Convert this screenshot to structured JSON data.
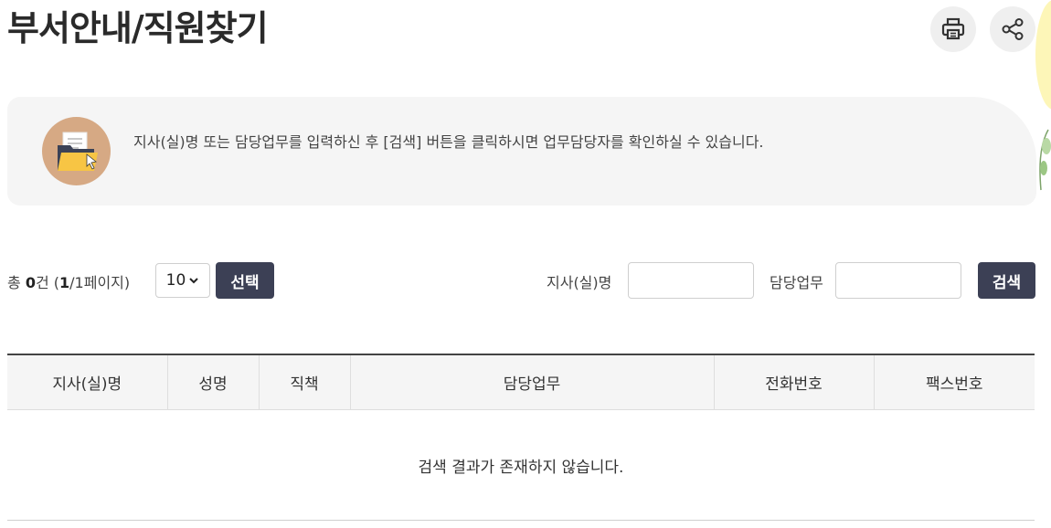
{
  "page": {
    "title": "부서안내/직원찾기"
  },
  "header_actions": {
    "print_icon": "printer-icon",
    "share_icon": "share-icon"
  },
  "info": {
    "icon": "folder-document-icon",
    "text": "지사(실)명 또는 담당업무를 입력하신 후 [검색] 버튼을 클릭하시면 업무담당자를 확인하실 수 있습니다."
  },
  "toolbar": {
    "total_prefix": "총 ",
    "total_count": "0",
    "total_suffix": "건 (",
    "current_page": "1",
    "page_sep": "/",
    "total_pages": "1",
    "page_suffix": "페이지)",
    "per_page_value": "10",
    "select_label": "선택",
    "branch_label": "지사(실)명",
    "branch_value": "",
    "duty_label": "담당업무",
    "duty_value": "",
    "search_label": "검색"
  },
  "table": {
    "columns": [
      "지사(실)명",
      "성명",
      "직책",
      "담당업무",
      "전화번호",
      "팩스번호"
    ],
    "empty_message": "검색 결과가 존재하지 않습니다."
  },
  "colors": {
    "button_dark": "#3c4055",
    "info_bg": "#f5f5f5",
    "icon_circle": "#d6a984"
  }
}
